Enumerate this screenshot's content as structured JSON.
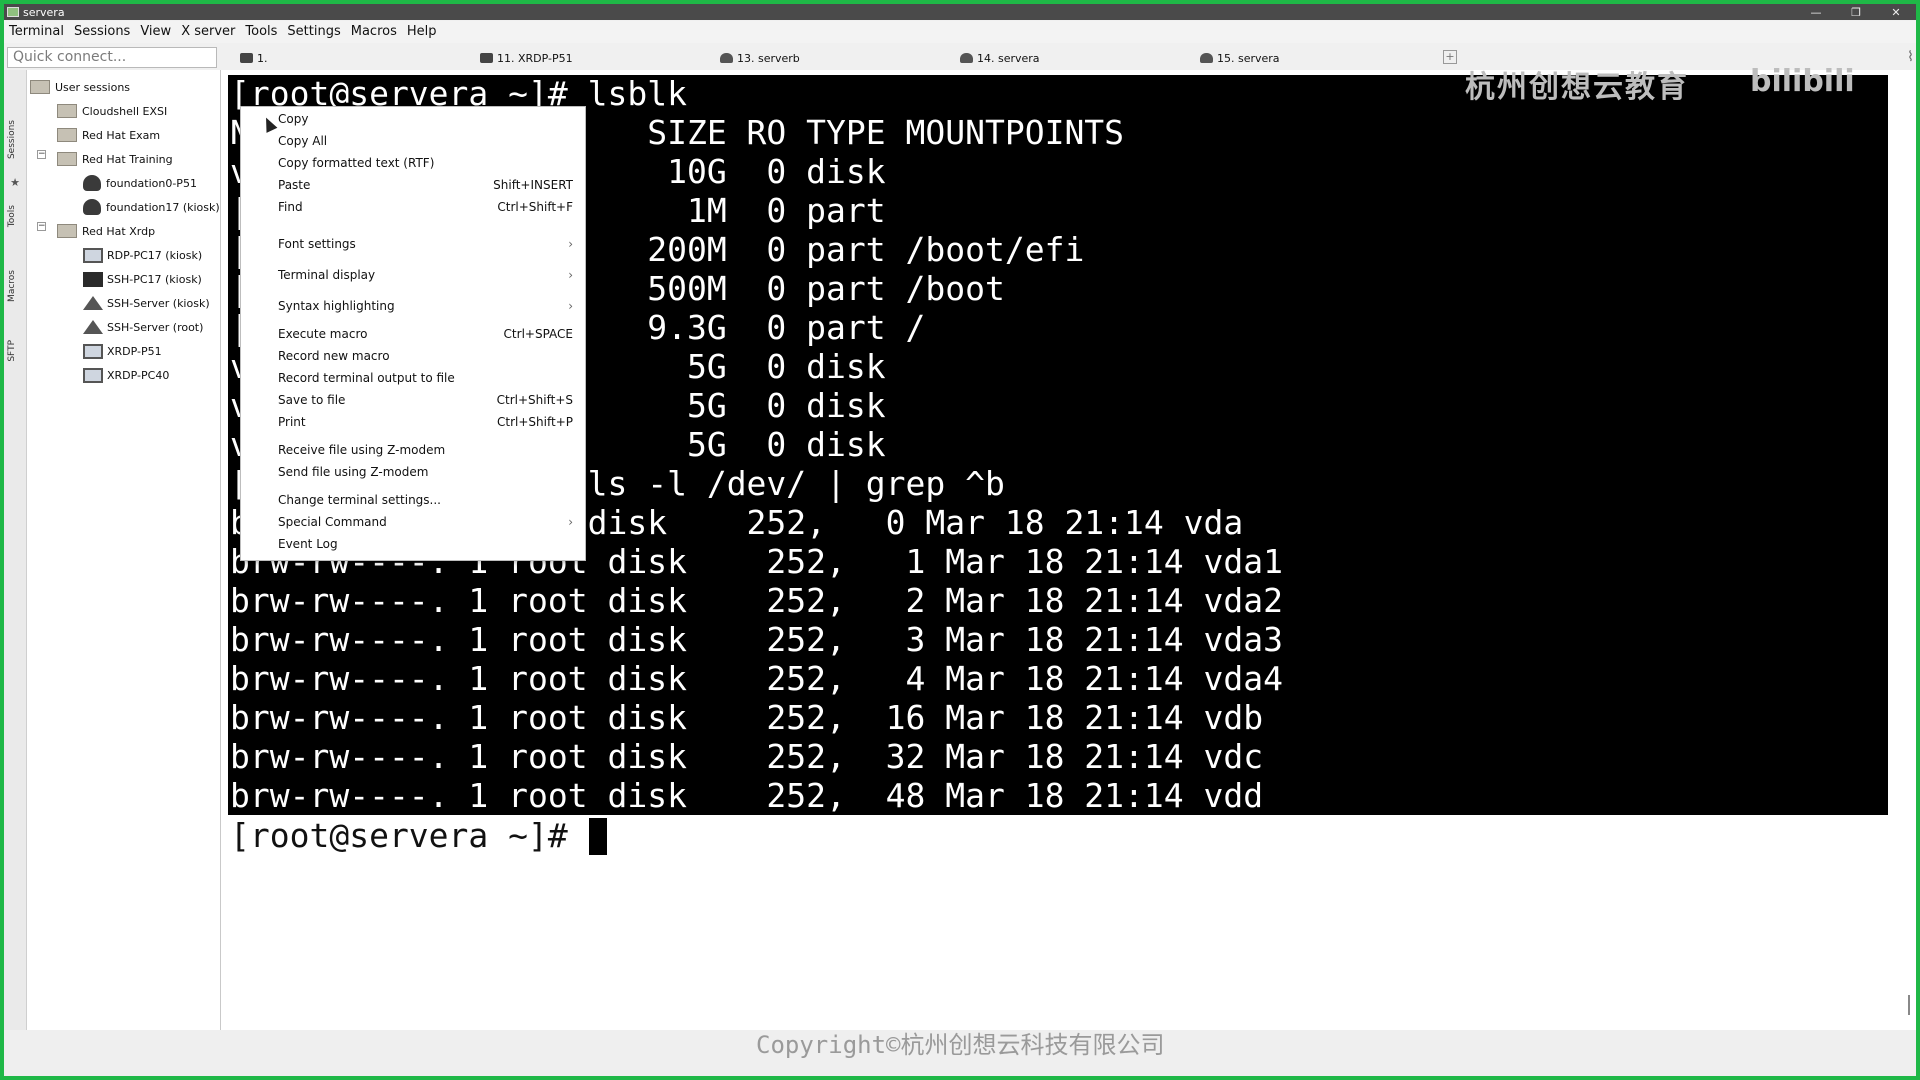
{
  "window": {
    "title": "servera",
    "controls": [
      "—",
      "❐",
      "✕"
    ]
  },
  "menubar": [
    "Terminal",
    "Sessions",
    "View",
    "X server",
    "Tools",
    "Settings",
    "Macros",
    "Help"
  ],
  "quick_connect": {
    "placeholder": "Quick connect..."
  },
  "tabs": [
    {
      "label": "1."
    },
    {
      "label": "11. XRDP-P51"
    },
    {
      "label": "13. serverb"
    },
    {
      "label": "14. servera"
    },
    {
      "label": "15. servera"
    }
  ],
  "side_tabs": [
    "Sessions",
    "Tools",
    "Macros",
    "SFTP"
  ],
  "sessions": {
    "root": "User sessions",
    "items": [
      {
        "label": "Cloudshell EXSI",
        "icon": "folder-icon"
      },
      {
        "label": "Red Hat Exam",
        "icon": "folder-icon"
      },
      {
        "label": "Red Hat Training",
        "icon": "folder-icon",
        "expander": "−"
      },
      {
        "label": "foundation0-P51",
        "icon": "linux-icon"
      },
      {
        "label": "foundation17 (kiosk)",
        "icon": "linux-icon"
      },
      {
        "label": "Red Hat Xrdp",
        "icon": "folder-icon",
        "expander": "−"
      },
      {
        "label": "RDP-PC17 (kiosk)",
        "icon": "rdp-icon"
      },
      {
        "label": "SSH-PC17 (kiosk)",
        "icon": "ssh-icon"
      },
      {
        "label": "SSH-Server (kiosk)",
        "icon": "server-icon"
      },
      {
        "label": "SSH-Server (root)",
        "icon": "server-icon"
      },
      {
        "label": "XRDP-P51",
        "icon": "xrdp-icon"
      },
      {
        "label": "XRDP-PC40",
        "icon": "xrdp-icon"
      }
    ]
  },
  "terminal": {
    "lines": [
      "[root@servera ~]# lsblk",
      "N                    SIZE RO TYPE MOUNTPOINTS",
      "v                     10G  0 disk",
      "|                      1M  0 part",
      "|                    200M  0 part /boot/efi",
      "|                    500M  0 part /boot",
      "|                    9.3G  0 part /",
      "v                      5G  0 disk",
      "v                      5G  0 disk",
      "v                      5G  0 disk",
      "[                 ls -l /dev/ | grep ^b",
      "b                 disk    252,   0 Mar 18 21:14 vda",
      "brw-rw----. 1 root disk    252,   1 Mar 18 21:14 vda1",
      "brw-rw----. 1 root disk    252,   2 Mar 18 21:14 vda2",
      "brw-rw----. 1 root disk    252,   3 Mar 18 21:14 vda3",
      "brw-rw----. 1 root disk    252,   4 Mar 18 21:14 vda4",
      "brw-rw----. 1 root disk    252,  16 Mar 18 21:14 vdb",
      "brw-rw----. 1 root disk    252,  32 Mar 18 21:14 vdc",
      "brw-rw----. 1 root disk    252,  48 Mar 18 21:14 vdd"
    ],
    "prompt": "[root@servera ~]# ",
    "watermark": "杭州创想云教育",
    "logo": "bilibili"
  },
  "context_menu": [
    {
      "label": "Copy",
      "shortcut": ""
    },
    {
      "label": "Copy All",
      "shortcut": ""
    },
    {
      "label": "Copy formatted text (RTF)",
      "shortcut": ""
    },
    {
      "label": "Paste",
      "shortcut": "Shift+INSERT"
    },
    {
      "label": "Find",
      "shortcut": "Ctrl+Shift+F"
    },
    {
      "label": "Font settings",
      "shortcut": "›"
    },
    {
      "label": "Terminal display",
      "shortcut": "›"
    },
    {
      "label": "Syntax highlighting",
      "shortcut": "›"
    },
    {
      "label": "Execute macro",
      "shortcut": "Ctrl+SPACE"
    },
    {
      "label": "Record new macro",
      "shortcut": ""
    },
    {
      "label": "Record terminal output to file",
      "shortcut": ""
    },
    {
      "label": "Save to file",
      "shortcut": "Ctrl+Shift+S"
    },
    {
      "label": "Print",
      "shortcut": "Ctrl+Shift+P"
    },
    {
      "label": "Receive file using Z-modem",
      "shortcut": ""
    },
    {
      "label": "Send file using Z-modem",
      "shortcut": ""
    },
    {
      "label": "Change terminal settings...",
      "shortcut": ""
    },
    {
      "label": "Special Command",
      "shortcut": "›"
    },
    {
      "label": "Event Log",
      "shortcut": ""
    }
  ],
  "footer": {
    "copyright": "Copyright©杭州创想云科技有限公司"
  },
  "colors": {
    "frame_border": "#1fb847",
    "terminal_bg": "#000000",
    "terminal_fg": "#ffffff"
  }
}
